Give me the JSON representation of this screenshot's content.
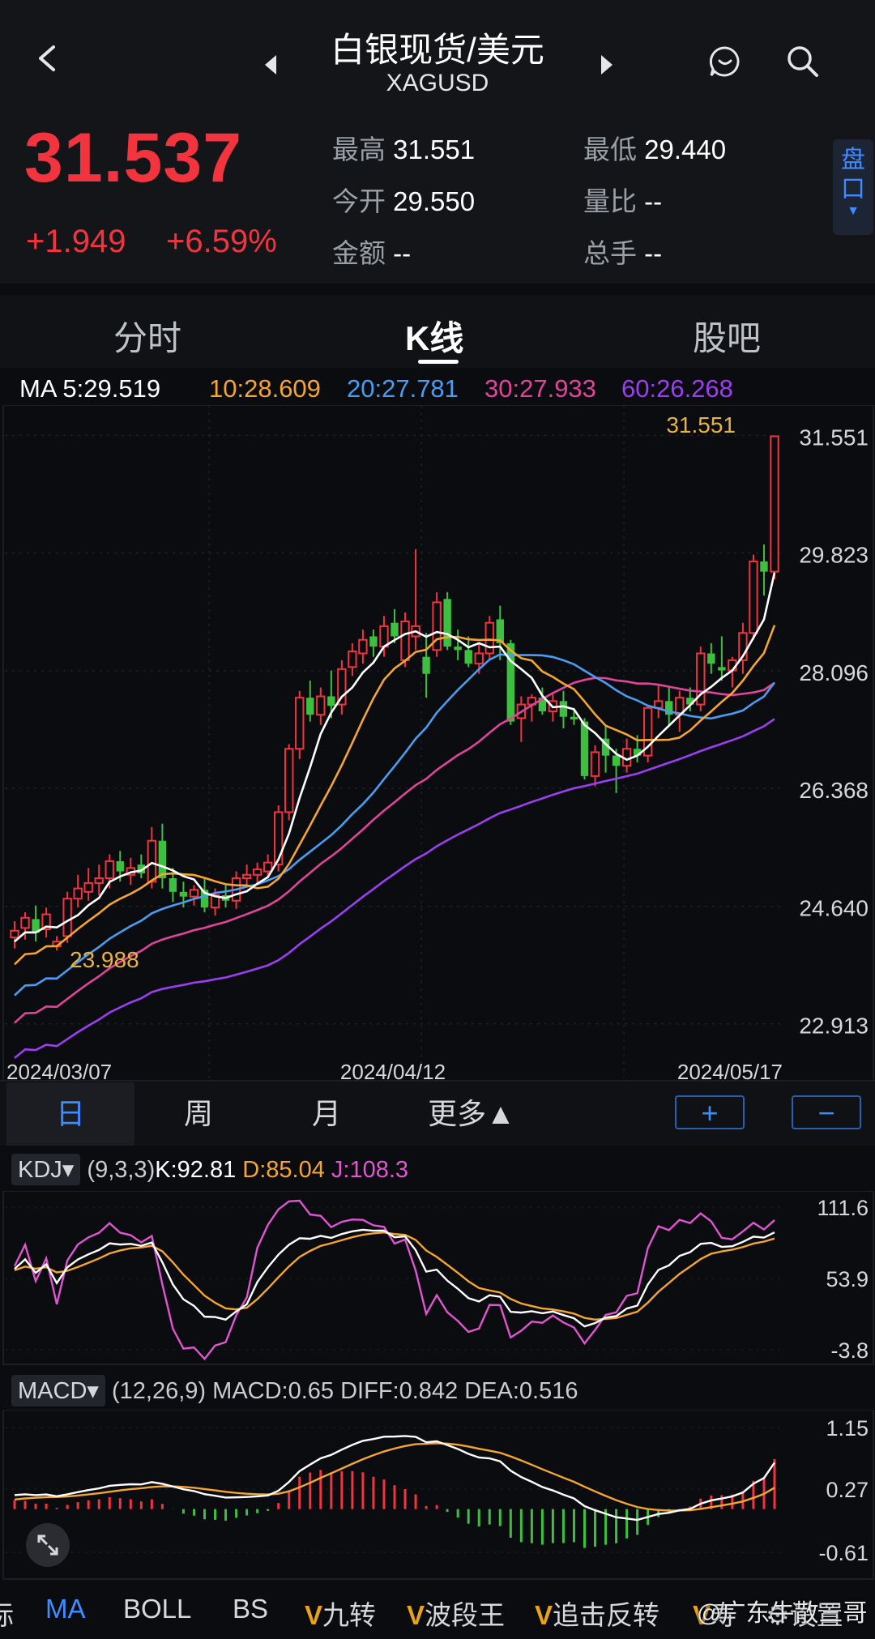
{
  "header": {
    "title": "白银现货/美元",
    "subtitle": "XAGUSD"
  },
  "quote": {
    "price": "31.537",
    "change": "+1.949",
    "change_pct": "+6.59%",
    "high_label": "最高",
    "high": "31.551",
    "low_label": "最低",
    "low": "29.440",
    "open_label": "今开",
    "open": "29.550",
    "volratio_label": "量比",
    "volratio": "--",
    "amount_label": "金额",
    "amount": "--",
    "turnover_label": "总手",
    "turnover": "--",
    "pankou": "盘口"
  },
  "tabs": [
    "分时",
    "K线",
    "股吧"
  ],
  "ma_legend": {
    "ma5": "MA 5:29.519",
    "ma10": "10:28.609",
    "ma20": "20:27.781",
    "ma30": "30:27.933",
    "ma60": "60:26.268"
  },
  "colors": {
    "up": "#f2343f",
    "down": "#3fbf3f",
    "ma5": "#ffffff",
    "ma10": "#f5a531",
    "ma20": "#4a9df0",
    "ma30": "#e0459a",
    "ma60": "#9b3ff0",
    "accent": "#3f8cff"
  },
  "periods": [
    "日",
    "周",
    "月",
    "更多▲"
  ],
  "zoom_in": "+",
  "zoom_out": "−",
  "kdj": {
    "name": "KDJ▾",
    "params": "(9,3,3)",
    "k": "K:92.81",
    "d": "D:85.04",
    "j": "J:108.3",
    "ticks": [
      "111.6",
      "53.9",
      "-3.8"
    ]
  },
  "macd": {
    "name": "MACD▾",
    "params": "(12,26,9)",
    "macd": "MACD:0.65",
    "diff": "DIFF:0.842",
    "dea": "DEA:0.516",
    "ticks": [
      "1.15",
      "0.27",
      "-0.61"
    ]
  },
  "bottom_tools": [
    "标",
    "MA",
    "BOLL",
    "BS",
    "九转",
    "波段王",
    "追击反转",
    "寿",
    "设置"
  ],
  "watermark": "@广东牛散三哥",
  "chart_data": {
    "type": "candlestick",
    "y_ticks": [
      31.551,
      29.823,
      28.096,
      26.368,
      24.64,
      22.913
    ],
    "ylim": [
      22.6,
      31.9
    ],
    "x_labels": [
      "2024/03/07",
      "2024/04/12",
      "2024/05/17"
    ],
    "annotations": [
      "31.551",
      "23.988"
    ],
    "candles": [
      [
        24.18,
        24.42,
        24.02,
        24.28
      ],
      [
        24.32,
        24.55,
        24.15,
        24.47
      ],
      [
        24.45,
        24.65,
        24.12,
        24.25
      ],
      [
        24.3,
        24.62,
        24.18,
        24.52
      ],
      [
        24.05,
        24.2,
        23.99,
        24.12
      ],
      [
        24.2,
        24.85,
        24.1,
        24.75
      ],
      [
        24.75,
        25.1,
        24.62,
        24.9
      ],
      [
        24.85,
        25.2,
        24.72,
        24.98
      ],
      [
        24.98,
        25.25,
        24.8,
        25.05
      ],
      [
        25.05,
        25.4,
        24.9,
        25.3
      ],
      [
        25.3,
        25.45,
        25.0,
        25.15
      ],
      [
        25.1,
        25.35,
        24.95,
        25.2
      ],
      [
        25.25,
        25.4,
        25.05,
        25.12
      ],
      [
        25.0,
        25.8,
        24.9,
        25.6
      ],
      [
        25.6,
        25.85,
        24.9,
        25.05
      ],
      [
        25.05,
        25.2,
        24.7,
        24.85
      ],
      [
        24.85,
        25.0,
        24.62,
        24.78
      ],
      [
        24.78,
        24.95,
        24.65,
        24.88
      ],
      [
        24.88,
        25.05,
        24.55,
        24.62
      ],
      [
        24.62,
        24.9,
        24.5,
        24.8
      ],
      [
        24.8,
        24.95,
        24.62,
        24.72
      ],
      [
        24.72,
        25.15,
        24.6,
        25.05
      ],
      [
        25.05,
        25.25,
        24.95,
        25.1
      ],
      [
        25.1,
        25.28,
        24.98,
        25.18
      ],
      [
        25.15,
        25.4,
        25.05,
        25.28
      ],
      [
        25.25,
        26.12,
        25.15,
        26.02
      ],
      [
        26.02,
        27.02,
        25.9,
        26.95
      ],
      [
        26.95,
        27.8,
        26.8,
        27.7
      ],
      [
        27.7,
        27.95,
        27.35,
        27.45
      ],
      [
        27.45,
        27.85,
        27.3,
        27.72
      ],
      [
        27.72,
        28.1,
        27.4,
        27.58
      ],
      [
        27.6,
        28.25,
        27.45,
        28.12
      ],
      [
        28.15,
        28.5,
        28.02,
        28.38
      ],
      [
        28.35,
        28.7,
        28.2,
        28.55
      ],
      [
        28.6,
        28.7,
        28.3,
        28.45
      ],
      [
        28.45,
        28.9,
        28.3,
        28.75
      ],
      [
        28.8,
        29.0,
        28.5,
        28.6
      ],
      [
        28.25,
        28.95,
        28.15,
        28.82
      ],
      [
        28.6,
        29.88,
        28.4,
        28.75
      ],
      [
        28.3,
        28.65,
        27.7,
        28.05
      ],
      [
        28.4,
        29.25,
        28.3,
        29.1
      ],
      [
        29.15,
        29.25,
        28.4,
        28.45
      ],
      [
        28.45,
        28.7,
        28.25,
        28.4
      ],
      [
        28.4,
        28.6,
        28.15,
        28.2
      ],
      [
        28.2,
        28.5,
        28.05,
        28.35
      ],
      [
        28.35,
        28.9,
        28.25,
        28.8
      ],
      [
        28.85,
        29.05,
        28.25,
        28.5
      ],
      [
        28.5,
        28.55,
        27.3,
        27.35
      ],
      [
        27.4,
        27.72,
        27.05,
        27.6
      ],
      [
        27.6,
        27.75,
        27.35,
        27.7
      ],
      [
        27.7,
        27.85,
        27.45,
        27.5
      ],
      [
        27.5,
        27.75,
        27.35,
        27.65
      ],
      [
        27.65,
        27.8,
        27.25,
        27.42
      ],
      [
        27.42,
        27.55,
        27.3,
        27.38
      ],
      [
        27.35,
        27.4,
        26.5,
        26.55
      ],
      [
        26.55,
        27.0,
        26.4,
        26.9
      ],
      [
        27.1,
        27.3,
        26.6,
        26.85
      ],
      [
        26.85,
        26.95,
        26.3,
        26.7
      ],
      [
        26.7,
        27.1,
        26.6,
        26.95
      ],
      [
        26.95,
        27.15,
        26.75,
        26.85
      ],
      [
        26.85,
        27.6,
        26.75,
        27.55
      ],
      [
        27.55,
        27.9,
        27.4,
        27.65
      ],
      [
        27.65,
        27.85,
        27.3,
        27.45
      ],
      [
        27.45,
        27.8,
        27.2,
        27.7
      ],
      [
        27.7,
        27.85,
        27.5,
        27.6
      ],
      [
        27.6,
        28.45,
        27.5,
        28.35
      ],
      [
        28.35,
        28.5,
        28.05,
        28.2
      ],
      [
        28.15,
        28.6,
        27.95,
        28.1
      ],
      [
        28.1,
        28.3,
        27.85,
        28.25
      ],
      [
        28.25,
        28.8,
        28.05,
        28.65
      ],
      [
        28.65,
        29.8,
        28.55,
        29.7
      ],
      [
        29.7,
        29.95,
        29.2,
        29.55
      ],
      [
        29.55,
        31.551,
        29.44,
        31.537
      ]
    ],
    "ma_lines_endpoints": {
      "ma5": 29.519,
      "ma10": 28.609,
      "ma20": 27.781,
      "ma30": 27.933,
      "ma60": 26.268
    }
  }
}
